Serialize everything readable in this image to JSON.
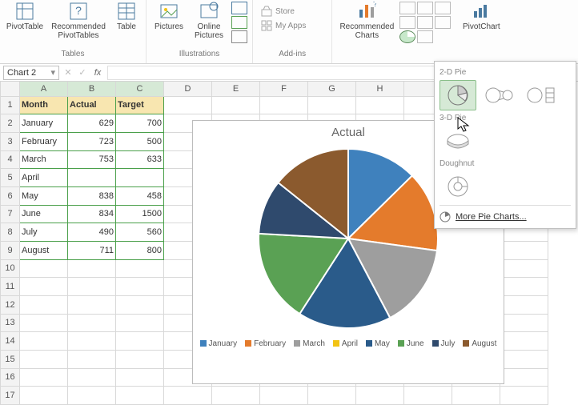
{
  "ribbon": {
    "tables_group": "Tables",
    "illus_group": "Illustrations",
    "addins_group": "Add-ins",
    "pivot_table": "PivotTable",
    "rec_pivot": "Recommended PivotTables",
    "table": "Table",
    "pictures": "Pictures",
    "online_pictures": "Online Pictures",
    "store": "Store",
    "my_apps": "My Apps",
    "rec_charts": "Recommended Charts",
    "pivot_chart": "PivotChart"
  },
  "namebox": "Chart 2",
  "headers": {
    "A": "A",
    "B": "B",
    "C": "C",
    "D": "D",
    "E": "E",
    "F": "F",
    "G": "G",
    "H": "H"
  },
  "row1": {
    "month": "Month",
    "actual": "Actual",
    "target": "Target"
  },
  "rows": [
    {
      "r": "1"
    },
    {
      "r": "2",
      "month": "January",
      "actual": "629",
      "target": "700"
    },
    {
      "r": "3",
      "month": "February",
      "actual": "723",
      "target": "500"
    },
    {
      "r": "4",
      "month": "March",
      "actual": "753",
      "target": "633"
    },
    {
      "r": "5",
      "month": "April",
      "actual": "",
      "target": ""
    },
    {
      "r": "6",
      "month": "May",
      "actual": "838",
      "target": "458"
    },
    {
      "r": "7",
      "month": "June",
      "actual": "834",
      "target": "1500"
    },
    {
      "r": "8",
      "month": "July",
      "actual": "490",
      "target": "560"
    },
    {
      "r": "9",
      "month": "August",
      "actual": "711",
      "target": "800"
    },
    {
      "r": "10"
    },
    {
      "r": "11"
    },
    {
      "r": "12"
    },
    {
      "r": "13"
    },
    {
      "r": "14"
    },
    {
      "r": "15"
    },
    {
      "r": "16"
    },
    {
      "r": "17"
    }
  ],
  "dropdown": {
    "h2d": "2-D Pie",
    "h3d": "3-D Pie",
    "hDonut": "Doughnut",
    "more": "More Pie Charts..."
  },
  "chart_title": "Actual",
  "legend": [
    "January",
    "February",
    "March",
    "April",
    "May",
    "June",
    "July",
    "August"
  ],
  "chart_data": {
    "type": "pie",
    "title": "Actual",
    "categories": [
      "January",
      "February",
      "March",
      "April",
      "May",
      "June",
      "July",
      "August"
    ],
    "values": [
      629,
      723,
      753,
      0,
      838,
      834,
      490,
      711
    ],
    "colors": [
      "#3f81bd",
      "#e47b2c",
      "#9e9e9e",
      "#f2c314",
      "#2a5b8a",
      "#5aa154",
      "#2f4a6d",
      "#8b5a2e"
    ]
  }
}
